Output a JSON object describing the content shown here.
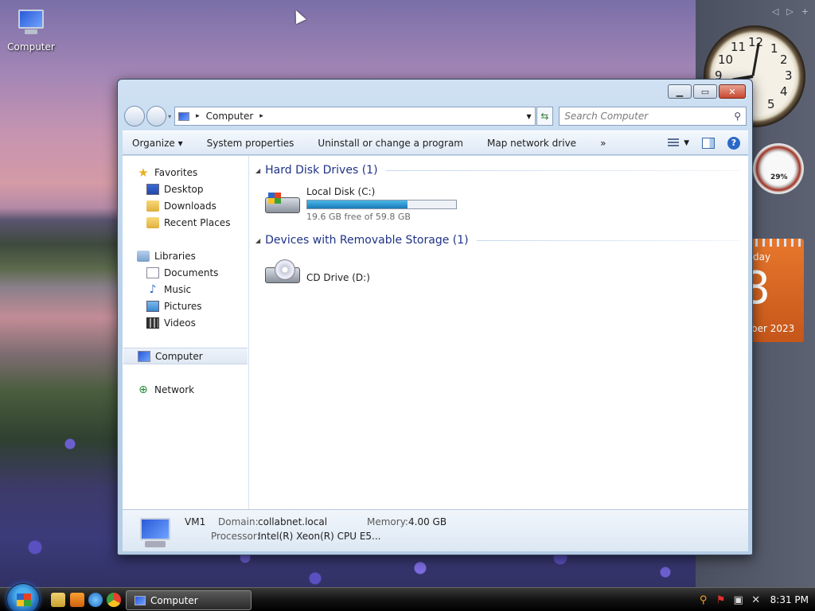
{
  "desktop": {
    "icon_label": "Computer"
  },
  "gadgets": {
    "clock_numbers": [
      "12",
      "1",
      "2",
      "3",
      "4",
      "5",
      "9",
      "10",
      "11"
    ],
    "meter_percent": "29%",
    "calendar_day": "day",
    "calendar_number": "8",
    "calendar_month": "ber 2023"
  },
  "window": {
    "address": {
      "location": "Computer",
      "separator": "▸"
    },
    "search_placeholder": "Search Computer",
    "toolbar": {
      "organize": "Organize ▾",
      "system_properties": "System properties",
      "uninstall": "Uninstall or change a program",
      "map_drive": "Map network drive",
      "more": "»"
    },
    "nav": {
      "favorites": "Favorites",
      "desktop": "Desktop",
      "downloads": "Downloads",
      "recent": "Recent Places",
      "libraries": "Libraries",
      "documents": "Documents",
      "music": "Music",
      "pictures": "Pictures",
      "videos": "Videos",
      "computer": "Computer",
      "network": "Network"
    },
    "groups": {
      "hdd_title": "Hard Disk Drives (1)",
      "removable_title": "Devices with Removable Storage (1)"
    },
    "drives": {
      "c_name": "Local Disk (C:)",
      "c_free": "19.6 GB free of 59.8 GB",
      "c_used_fraction": 0.672,
      "d_name": "CD Drive (D:)"
    },
    "details": {
      "name": "VM1",
      "domain_label": "Domain:",
      "domain_value": "collabnet.local",
      "memory_label": "Memory:",
      "memory_value": "4.00 GB",
      "processor_label": "Processor:",
      "processor_value": "Intel(R) Xeon(R) CPU E5..."
    }
  },
  "taskbar": {
    "task_label": "Computer",
    "time": "8:31 PM"
  }
}
